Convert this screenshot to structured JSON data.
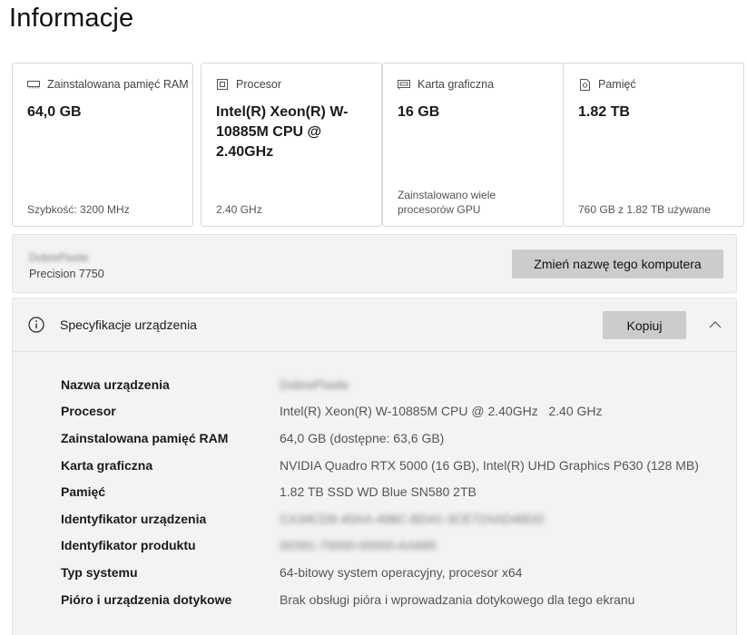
{
  "page": {
    "title": "Informacje"
  },
  "cards": [
    {
      "icon": "ram-icon",
      "label": "Zainstalowana pamięć RAM",
      "value": "64,0 GB",
      "sub": "Szybkość: 3200 MHz"
    },
    {
      "icon": "processor-icon",
      "label": "Procesor",
      "value": "Intel(R) Xeon(R) W-10885M CPU @ 2.40GHz",
      "sub": "2.40 GHz"
    },
    {
      "icon": "graphics-card-icon",
      "label": "Karta graficzna",
      "value": "16 GB",
      "sub": "Zainstalowano wiele procesorów GPU"
    },
    {
      "icon": "storage-icon",
      "label": "Pamięć",
      "value": "1.82 TB",
      "sub": "760 GB z 1.82 TB używane"
    }
  ],
  "device": {
    "hostname": "DobrePixele",
    "model": "Precision 7750",
    "rename_button": "Zmień nazwę tego komputera"
  },
  "specs": {
    "title": "Specyfikacje urządzenia",
    "copy_button": "Kopiuj",
    "rows": [
      {
        "key": "Nazwa urządzenia",
        "value": "DobrePixele",
        "blurred": true
      },
      {
        "key": "Procesor",
        "value": "Intel(R) Xeon(R) W-10885M CPU @ 2.40GHz   2.40 GHz",
        "blurred": false
      },
      {
        "key": "Zainstalowana pamięć RAM",
        "value": "64,0 GB (dostępne: 63,6 GB)",
        "blurred": false
      },
      {
        "key": "Karta graficzna",
        "value": "NVIDIA Quadro RTX 5000 (16 GB), Intel(R) UHD Graphics P630 (128 MB)",
        "blurred": false
      },
      {
        "key": "Pamięć",
        "value": "1.82 TB SSD WD Blue SN580 2TB",
        "blurred": false
      },
      {
        "key": "Identyfikator urządzenia",
        "value": "CA34CD6-40AA-498C-BD41-3CE72AAD48DD",
        "blurred": true
      },
      {
        "key": "Identyfikator produktu",
        "value": "00391-70000-00000-AA685",
        "blurred": true
      },
      {
        "key": "Typ systemu",
        "value": "64-bitowy system operacyjny, procesor x64",
        "blurred": false
      },
      {
        "key": "Pióro i urządzenia dotykowe",
        "value": "Brak obsługi pióra i wprowadzania dotykowego dla tego ekranu",
        "blurred": false
      }
    ]
  }
}
